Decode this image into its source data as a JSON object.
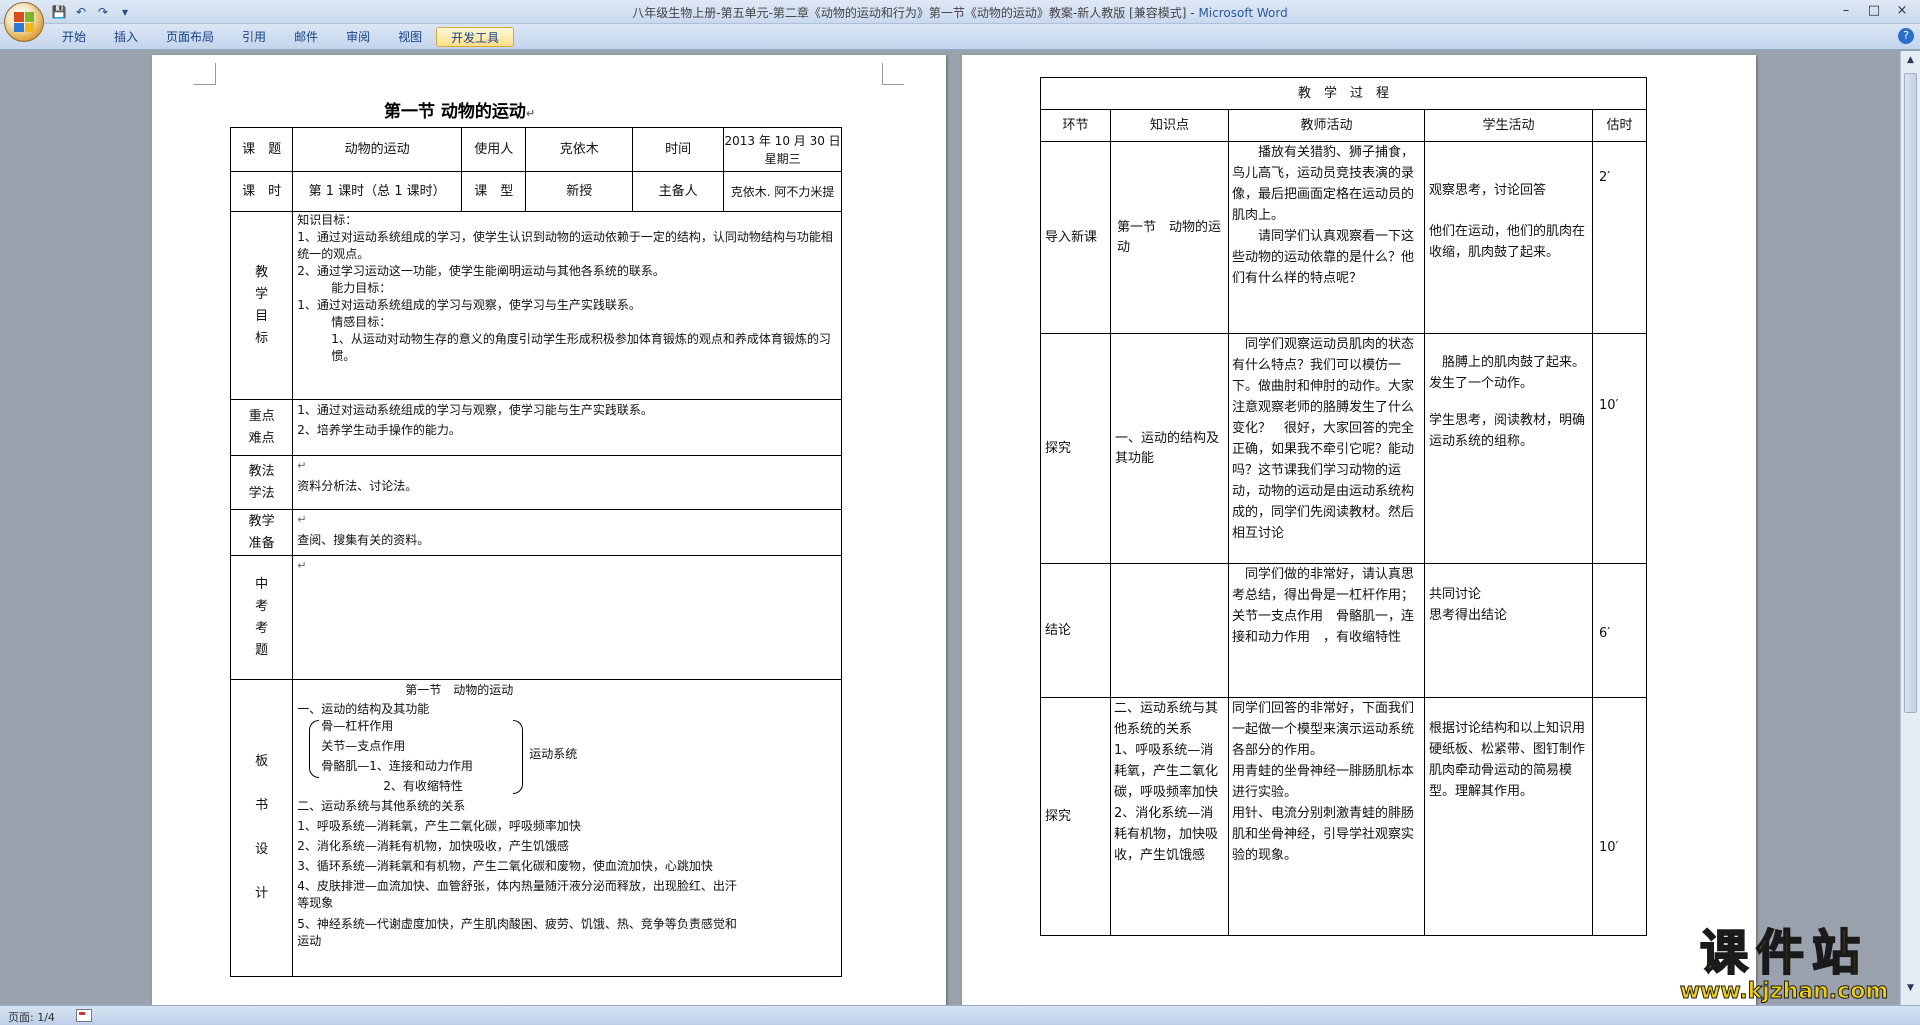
{
  "window": {
    "title": "八年级生物上册-第五单元-第二章《动物的运动和行为》第一节《动物的运动》教案-新人教版 [兼容模式]",
    "app_name": "Microsoft Word",
    "minimize": "–",
    "maximize": "□",
    "close": "×"
  },
  "ribbon": {
    "tabs": [
      "开始",
      "插入",
      "页面布局",
      "引用",
      "邮件",
      "审阅",
      "视图",
      "开发工具"
    ],
    "active_tab": "开发工具",
    "help": "?"
  },
  "qat": [
    "💾",
    "↶",
    "↷",
    "▾"
  ],
  "status": {
    "page": "页面: 1/4"
  },
  "para_mark": "↵",
  "left_page": {
    "title": "第一节  动物的运动",
    "row1": {
      "topic_label": "课　题",
      "topic": "动物的运动",
      "user_label": "使用人",
      "user": "克依木",
      "time_label": "时间",
      "time": "2013 年 10 月 30 日星期三"
    },
    "row2": {
      "hours_label": "课　时",
      "hours": "第 1 课时（总 1 课时）",
      "type_label": "课　型",
      "type": "新授",
      "prep_label": "主备人",
      "prep": "克依木. 阿不力米提"
    },
    "goals_label": [
      "教",
      "学",
      "目",
      "标"
    ],
    "goals": [
      "知识目标：",
      "1、通过对运动系统组成的学习，使学生认识到动物的运动依赖于一定的结构，认同动物结构与功能相统一的观点。",
      "2、通过学习运动这一功能，使学生能阐明运动与其他各系统的联系。",
      "能力目标：",
      "1、通过对运动系统组成的学习与观察，使学习与生产实践联系。",
      "情感目标：",
      "1、从运动对动物生存的意义的角度引动学生形成积极参加体育锻炼的观点和养成体育锻炼的习惯。"
    ],
    "key_label": [
      "重点",
      "难点"
    ],
    "key": [
      "1、通过对运动系统组成的学习与观察，使学习能与生产实践联系。",
      "2、培养学生动手操作的能力。"
    ],
    "method_label": [
      "教法",
      "学法"
    ],
    "method": "资料分析法、讨论法。",
    "prep_label": [
      "教学",
      "准备"
    ],
    "prep": "查阅、搜集有关的资料。",
    "exam_label": [
      "中",
      "考",
      "考",
      "题"
    ],
    "board_label": [
      "板",
      "书",
      "设",
      "计"
    ],
    "board": {
      "title": "第一节　动物的运动",
      "s1": "一、运动的结构及其功能",
      "items": [
        "骨—杠杆作用",
        "关节—支点作用",
        "骨骼肌—1、连接和动力作用"
      ],
      "item4": "2、有收缩特性",
      "system": "运动系统",
      "s2": "二、运动系统与其他系统的关系",
      "rel": [
        "1、呼吸系统—消耗氧，产生二氧化碳，呼吸频率加快",
        "2、消化系统—消耗有机物，加快吸收，产生饥饿感",
        "3、循环系统—消耗氧和有机物，产生二氧化碳和废物，使血流加快，心跳加快",
        "4、皮肤排泄—血流加快、血管舒张，体内热量随汗液分泌而释放，出现脸红、出汗等现象",
        "5、神经系统—代谢虚度加快，产生肌肉酸困、疲劳、饥饿、热、竞争等负责感觉和运动"
      ]
    }
  },
  "right_page": {
    "header": "教　学　过　程",
    "cols": [
      "环节",
      "知识点",
      "教师活动",
      "学生活动",
      "估时"
    ],
    "rows": [
      {
        "stage": "导入新课",
        "point": "第一节　动物的运动",
        "teacher": [
          "播放有关猎豹、狮子捕食，鸟儿高飞，运动员竞技表演的录像，最后把画面定格在运动员的肌肉上。",
          "请同学们认真观察看一下这些动物的运动依靠的是什么？他们有什么样的特点呢？"
        ],
        "student": [
          "观察思考，讨论回答",
          "他们在运动，他们的肌肉在收缩，肌肉鼓了起来。"
        ],
        "time": "2′"
      },
      {
        "stage": "探究",
        "point": "一、运动的结构及其功能",
        "teacher": [
          "同学们观察运动员肌肉的状态有什么特点？我们可以模仿一下。做曲肘和伸肘的动作。大家注意观察老师的胳膊发生了什么变化？　很好，大家回答的完全正确，如果我不牵引它呢？能动吗？这节课我们学习动物的运动，动物的运动是由运动系统构成的，同学们先阅读教材。然后相互讨论"
        ],
        "student": [
          "胳膊上的肌肉鼓了起来。",
          "发生了一个动作。",
          "学生思考，阅读教材，明确运动系统的组称。"
        ],
        "time": "10′"
      },
      {
        "stage": "结论",
        "point": "",
        "teacher": [
          "同学们做的非常好，请认真思考总结，得出骨是一杠杆作用；关节一支点作用　骨骼肌一，连接和动力作用　，有收缩特性"
        ],
        "student": [
          "共同讨论",
          "思考得出结论"
        ],
        "time": "6′"
      },
      {
        "stage": "探究",
        "point": "二、运动系统与其他系统的关系\n1、呼吸系统—消耗氧，产生二氧化碳，呼吸频率加快\n2、消化系统—消耗有机物，加快吸收，产生饥饿感",
        "teacher": [
          "同学们回答的非常好，下面我们一起做一个模型来演示运动系统各部分的作用。",
          "用青蛙的坐骨神经一腓肠肌标本进行实验。",
          "用针、电流分别刺激青蛙的腓肠肌和坐骨神经，引导学社观察实验的现象。"
        ],
        "student": [
          "根据讨论结构和以上知识用硬纸板、松紧带、图钉制作肌肉牵动骨运动的简易模型。理解其作用。"
        ],
        "time": "10′"
      }
    ]
  },
  "watermark": {
    "text": "课件站",
    "url": "www.kjzhan.com"
  }
}
